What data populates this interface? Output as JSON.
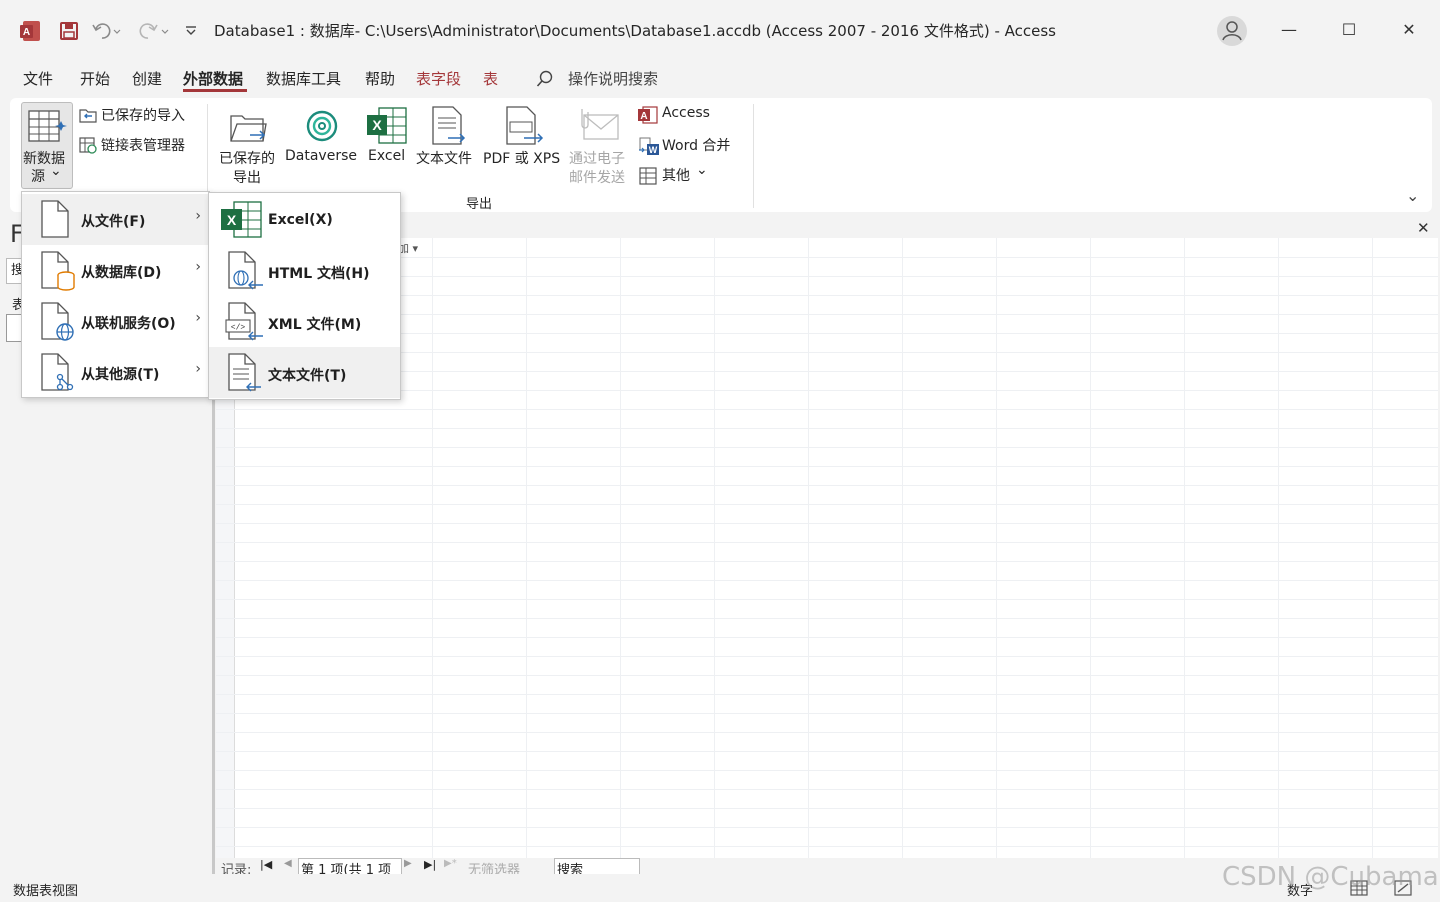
{
  "title_bar": {
    "app_icon": "access-logo-icon",
    "save_icon": "save-icon",
    "undo_icon": "undo-icon",
    "redo_icon": "redo-icon",
    "customize_icon": "customize-qat-icon",
    "title": "Database1 : 数据库- C:\\Users\\Administrator\\Documents\\Database1.accdb (Access 2007 - 2016 文件格式)  -  Access",
    "window_controls": {
      "minimize": "—",
      "maximize": "☐",
      "close": "✕"
    }
  },
  "menu_tabs": [
    {
      "label": "文件"
    },
    {
      "label": "开始"
    },
    {
      "label": "创建"
    },
    {
      "label": "外部数据",
      "active": true
    },
    {
      "label": "数据库工具"
    },
    {
      "label": "帮助"
    },
    {
      "label": "表字段",
      "contextual": true
    },
    {
      "label": "表",
      "contextual": true
    }
  ],
  "search": {
    "label": "操作说明搜索"
  },
  "ribbon": {
    "import_group": {
      "new_source": {
        "line1": "新数据",
        "line2": "源",
        "arrow": "⌄"
      },
      "saved_imports": "已保存的导入",
      "linked_table_manager": "链接表管理器"
    },
    "export_group": {
      "saved_exports": {
        "line1": "已保存的",
        "line2": "导出"
      },
      "dataverse": "Dataverse",
      "excel": "Excel",
      "text_file": "文本文件",
      "pdf_xps": "PDF 或 XPS",
      "email": {
        "line1": "通过电子",
        "line2": "邮件发送"
      },
      "access": "Access",
      "word_merge": "Word 合并",
      "other": "其他",
      "other_arrow": "⌄",
      "label": "导出"
    },
    "collapse_icon": "⌄"
  },
  "dropdown_sources": [
    {
      "label": "从文件(F)",
      "icon": "file-icon"
    },
    {
      "label": "从数据库(D)",
      "icon": "database-file-icon"
    },
    {
      "label": "从联机服务(O)",
      "icon": "online-service-icon"
    },
    {
      "label": "从其他源(T)",
      "icon": "other-source-icon"
    }
  ],
  "dropdown_files": [
    {
      "label": "Excel(X)",
      "icon": "excel-icon"
    },
    {
      "label": "HTML 文档(H)",
      "icon": "html-document-icon"
    },
    {
      "label": "XML 文件(M)",
      "icon": "xml-file-icon"
    },
    {
      "label": "文本文件(T)",
      "icon": "text-file-icon",
      "highlighted": true
    }
  ],
  "chevron_right": "›",
  "nav_pane": {
    "title_partial": "F",
    "search_partial": "搜",
    "section_partial": "表"
  },
  "workarea": {
    "close": "✕",
    "header_partial": "加 ▾"
  },
  "record_nav": {
    "label": "记录:",
    "first": "|◀",
    "prev": "◀",
    "position": "第 1 项(共 1 项",
    "next": "▶",
    "last": "▶|",
    "new": "▶*",
    "filter": "无筛选器",
    "search": "搜索"
  },
  "status_bar": {
    "left": "数据表视图",
    "num_lock": "数字",
    "watermark": "CSDN @Cubaman"
  }
}
